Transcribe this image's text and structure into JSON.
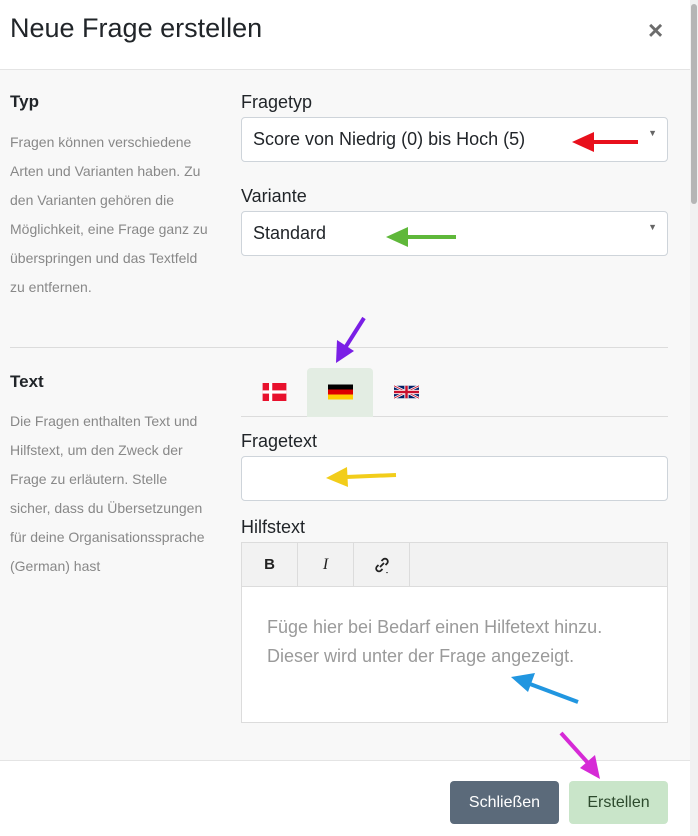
{
  "dialog": {
    "title": "Neue Frage erstellen",
    "close_symbol": "×"
  },
  "type_section": {
    "title": "Typ",
    "description": "Fragen können verschiedene Arten und Varianten haben. Zu den Varianten gehören die Möglichkeit, eine Frage ganz zu überspringen und das Textfeld zu entfernen.",
    "question_type": {
      "label": "Fragetyp",
      "value": "Score von Niedrig (0) bis Hoch (5)"
    },
    "variant": {
      "label": "Variante",
      "value": "Standard"
    }
  },
  "text_section": {
    "title": "Text",
    "description": "Die Fragen enthalten Text und Hilfstext, um den Zweck der Frage zu erläutern. Stelle sicher, dass du Übersetzungen für deine Organisationssprache (German) hast",
    "language_tabs": [
      {
        "lang": "Danish",
        "icon": "flag-dk-icon",
        "active": false
      },
      {
        "lang": "German",
        "icon": "flag-de-icon",
        "active": true
      },
      {
        "lang": "English",
        "icon": "flag-gb-icon",
        "active": false
      }
    ],
    "question_text": {
      "label": "Fragetext",
      "value": ""
    },
    "help_text": {
      "label": "Hilfstext",
      "toolbar": {
        "bold": "B",
        "italic": "I",
        "link_icon": "link-icon"
      },
      "placeholder": "Füge hier bei Bedarf einen Hilfetext hinzu. Dieser wird unter der Frage angezeigt."
    }
  },
  "footer": {
    "close_label": "Schließen",
    "create_label": "Erstellen"
  },
  "annotation_colors": {
    "red": "#e8101c",
    "green": "#5fb83a",
    "purple": "#7a1fe6",
    "yellow": "#f2cd1a",
    "blue": "#2196e0",
    "magenta": "#d62ad6"
  }
}
